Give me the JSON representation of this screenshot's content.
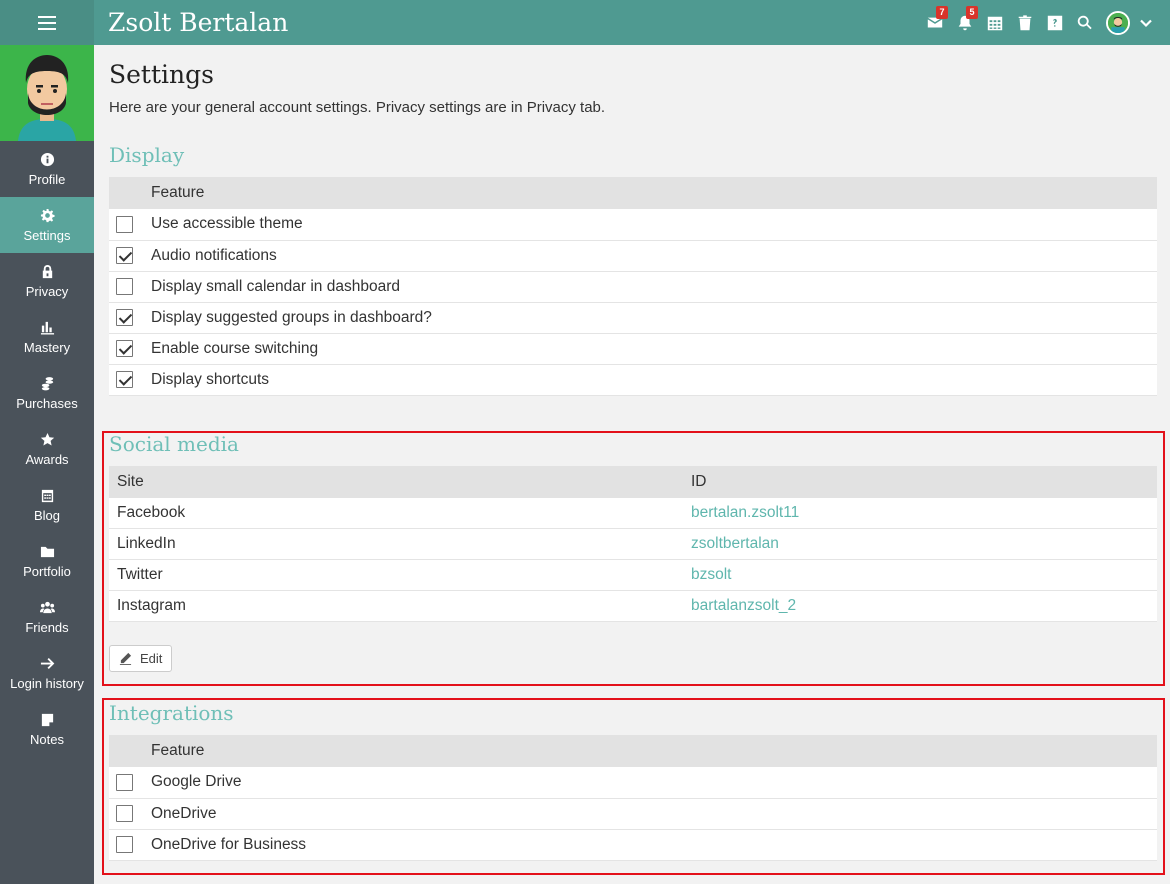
{
  "header": {
    "title": "Zsolt Bertalan",
    "messages_count": "7",
    "notifications_count": "5"
  },
  "sidebar": {
    "items": [
      {
        "label": "Profile",
        "icon": "info-icon"
      },
      {
        "label": "Settings",
        "icon": "gear-icon",
        "active": true
      },
      {
        "label": "Privacy",
        "icon": "lock-icon"
      },
      {
        "label": "Mastery",
        "icon": "bar-chart-icon"
      },
      {
        "label": "Purchases",
        "icon": "coins-icon"
      },
      {
        "label": "Awards",
        "icon": "star-icon"
      },
      {
        "label": "Blog",
        "icon": "calendar-icon"
      },
      {
        "label": "Portfolio",
        "icon": "folder-icon"
      },
      {
        "label": "Friends",
        "icon": "users-icon"
      },
      {
        "label": "Login history",
        "icon": "arrow-right-icon"
      },
      {
        "label": "Notes",
        "icon": "note-icon"
      }
    ]
  },
  "page": {
    "title": "Settings",
    "description": "Here are your general account settings. Privacy settings are in Privacy tab."
  },
  "display": {
    "title": "Display",
    "column": "Feature",
    "rows": [
      {
        "label": "Use accessible theme",
        "checked": false
      },
      {
        "label": "Audio notifications",
        "checked": true
      },
      {
        "label": "Display small calendar in dashboard",
        "checked": false
      },
      {
        "label": "Display suggested groups in dashboard?",
        "checked": true
      },
      {
        "label": "Enable course switching",
        "checked": true
      },
      {
        "label": "Display shortcuts",
        "checked": true
      }
    ]
  },
  "social": {
    "title": "Social media",
    "col_site": "Site",
    "col_id": "ID",
    "rows": [
      {
        "site": "Facebook",
        "id": "bertalan.zsolt11"
      },
      {
        "site": "LinkedIn",
        "id": "zsoltbertalan"
      },
      {
        "site": "Twitter",
        "id": "bzsolt"
      },
      {
        "site": "Instagram",
        "id": "bartalanzsolt_2"
      }
    ],
    "edit_label": "Edit"
  },
  "integrations": {
    "title": "Integrations",
    "column": "Feature",
    "rows": [
      {
        "label": "Google Drive",
        "checked": false
      },
      {
        "label": "OneDrive",
        "checked": false
      },
      {
        "label": "OneDrive for Business",
        "checked": false
      }
    ]
  },
  "colors": {
    "topbar": "#4f9a91",
    "sidebar": "#4a525a",
    "active_nav": "#5aa49b",
    "section_title": "#6fbfb7",
    "highlight_border": "#e3111a"
  }
}
